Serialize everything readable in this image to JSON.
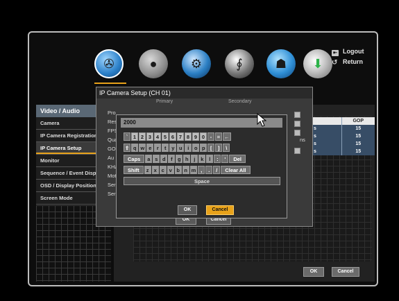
{
  "header": {
    "logout": "Logout",
    "return": "Return"
  },
  "section": {
    "title": "Video / Audio",
    "tab_fragment": "Vi"
  },
  "sidebar": {
    "items": [
      {
        "label": "Camera",
        "active": false
      },
      {
        "label": "IP Camera Registration",
        "active": false
      },
      {
        "label": "IP Camera Setup",
        "active": true
      },
      {
        "label": "Monitor",
        "active": false
      },
      {
        "label": "Sequence / Event Display",
        "active": false
      },
      {
        "label": "OSD / Display Position",
        "active": false
      },
      {
        "label": "Screen Mode",
        "active": false
      }
    ]
  },
  "gop_table": {
    "header_fragment": "",
    "header": "GOP",
    "rows": [
      {
        "fragment": "s",
        "value": "15"
      },
      {
        "fragment": "s",
        "value": "15"
      },
      {
        "fragment": "s",
        "value": "15"
      },
      {
        "fragment": "s",
        "value": "15"
      }
    ]
  },
  "main_buttons": {
    "ok": "OK",
    "cancel": "Cancel"
  },
  "setup_dialog": {
    "title": "IP Camera Setup  (CH 01)",
    "col_primary": "Primary",
    "col_secondary": "Secondary",
    "labels": [
      "Pro",
      "Res",
      "FPS",
      "Qua",
      "GOI",
      "Au",
      "KHz",
      "Mot",
      "Ser",
      "Ser"
    ],
    "right_fragment": "ns",
    "ok": "OK",
    "cancel": "Cancel"
  },
  "keyboard": {
    "input_value": "2000",
    "row1": [
      "`",
      "1",
      "2",
      "3",
      "4",
      "5",
      "6",
      "7",
      "8",
      "9",
      "0",
      "-",
      "=",
      "←"
    ],
    "row2": [
      "⇧",
      "q",
      "w",
      "e",
      "r",
      "t",
      "y",
      "u",
      "i",
      "o",
      "p",
      "[",
      "]",
      "\\"
    ],
    "row3": [
      "Caps",
      "a",
      "s",
      "d",
      "f",
      "g",
      "h",
      "j",
      "k",
      "l",
      ":",
      "'",
      "Del"
    ],
    "row4": [
      "Shift",
      "z",
      "x",
      "c",
      "v",
      "b",
      "n",
      "m",
      ",",
      ".",
      "/",
      "Clear All"
    ],
    "space": "Space",
    "ok": "OK",
    "cancel": "Cancel"
  },
  "icons": {
    "video": "video-reel-icon",
    "record": "hard-disk-icon",
    "settings": "gear-icon",
    "network": "network-icon",
    "system": "system-icon",
    "backup": "disc-backup-icon"
  },
  "colors": {
    "accent": "#e8a21a",
    "section": "#5a6875",
    "table_cell": "#374d66"
  }
}
